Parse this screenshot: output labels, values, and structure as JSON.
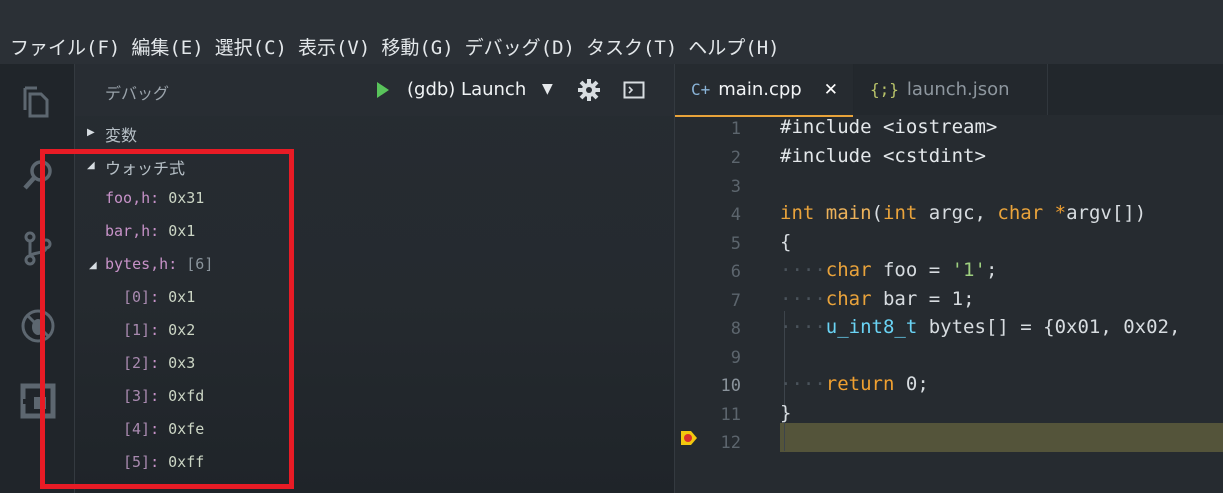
{
  "menu": [
    "ファイル(F)",
    "編集(E)",
    "選択(C)",
    "表示(V)",
    "移動(G)",
    "デバッグ(D)",
    "タスク(T)",
    "ヘルプ(H)"
  ],
  "activity_icons": [
    "files-icon",
    "search-icon",
    "source-control-icon",
    "debug-icon",
    "extensions-icon"
  ],
  "debug": {
    "title": "デバッグ",
    "config": "(gdb) Launch",
    "caret": "▼",
    "sections": {
      "variables": "変数",
      "watch": "ウォッチ式"
    },
    "watch": [
      {
        "name": "foo,h",
        "value": "0x31"
      },
      {
        "name": "bar,h",
        "value": "0x1"
      }
    ],
    "bytes": {
      "name": "bytes,h",
      "value": "[6]",
      "items": [
        {
          "index": "[0]",
          "value": "0x1"
        },
        {
          "index": "[1]",
          "value": "0x2"
        },
        {
          "index": "[2]",
          "value": "0x3"
        },
        {
          "index": "[3]",
          "value": "0xfd"
        },
        {
          "index": "[4]",
          "value": "0xfe"
        },
        {
          "index": "[5]",
          "value": "0xff"
        }
      ]
    }
  },
  "tabs": [
    {
      "icon": "C+",
      "label": "main.cpp",
      "close": "✕"
    },
    {
      "icon": "{;}",
      "label": "launch.json"
    }
  ],
  "code": {
    "line_numbers": [
      "1",
      "2",
      "3",
      "4",
      "5",
      "6",
      "7",
      "8",
      "9",
      "10",
      "11",
      "12"
    ],
    "current_line": "10",
    "lines": [
      "#include <iostream>",
      "#include <cstdint>",
      "",
      "int main(int argc, char *argv[])",
      "{",
      "    char foo = '1';",
      "    char bar = 1;",
      "    u_int8_t bytes[] = {0x01, 0x02,",
      "",
      "    return 0;",
      "}",
      ""
    ]
  },
  "colors": {
    "highlight_box": "#e81b25",
    "breakpoint": "#f2c80f",
    "accent": "#e8a33a",
    "run_green": "#59c35b"
  }
}
